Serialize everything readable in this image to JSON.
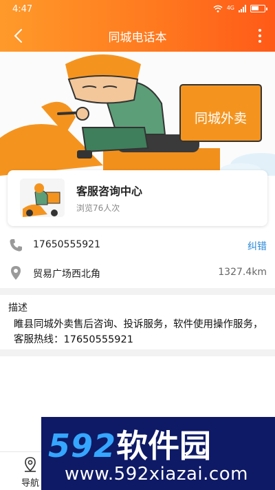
{
  "status_bar": {
    "time": "4:47",
    "network": "4G",
    "icons": [
      "wifi-icon",
      "signal-icon",
      "battery-icon"
    ]
  },
  "app_bar": {
    "title": "同城电话本",
    "back_icon": "back-arrow-icon",
    "more_icon": "more-vertical-icon"
  },
  "banner": {
    "box_label": "同城外卖"
  },
  "card": {
    "title": "客服咨询中心",
    "views": "浏览76人次"
  },
  "phone_row": {
    "icon": "phone-icon",
    "number": "17650555921",
    "action_label": "纠错"
  },
  "address_row": {
    "icon": "location-pin-icon",
    "address": "贸易广场西北角",
    "distance": "1327.4km"
  },
  "description": {
    "label": "描述",
    "text": "睢县同城外卖售后咨询、投诉服务，软件使用操作服务，客服热线：17650555921"
  },
  "bottom_nav": {
    "navigate_label": "导航",
    "navigate_icon": "navigation-pin-icon"
  },
  "watermark": {
    "logo_digits": "592",
    "logo_cn": "软件园",
    "url": "www.592xiazai.com"
  },
  "colors": {
    "header_start": "#ff9a2a",
    "header_end": "#ff5a18",
    "link": "#2b8ad8",
    "watermark_bg": "#0e1a66",
    "watermark_digits": "#35a6ff"
  }
}
